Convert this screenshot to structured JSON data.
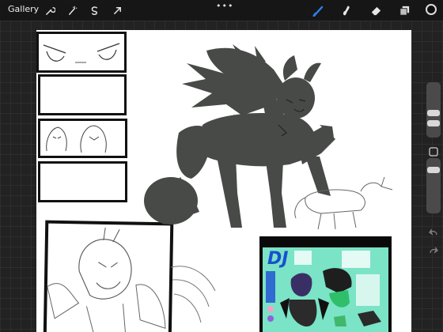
{
  "topbar": {
    "gallery_label": "Gallery",
    "more_label": "•••",
    "left_tools": [
      "wrench-icon",
      "magic-wand-icon",
      "selection-icon",
      "transform-arrow-icon"
    ],
    "right_tools": [
      "brush-icon",
      "smudge-icon",
      "eraser-icon",
      "layers-icon"
    ],
    "active_tool": "brush-icon",
    "active_color": "#0e0e0e",
    "accent": "#2f7ff2"
  },
  "sidebar": {
    "controls": [
      "brush-size-slider",
      "modify-button",
      "brush-opacity-slider",
      "undo-button",
      "redo-button"
    ]
  },
  "canvas": {
    "background": "#ffffff",
    "reference_sheet": {
      "title": "DJ"
    }
  }
}
